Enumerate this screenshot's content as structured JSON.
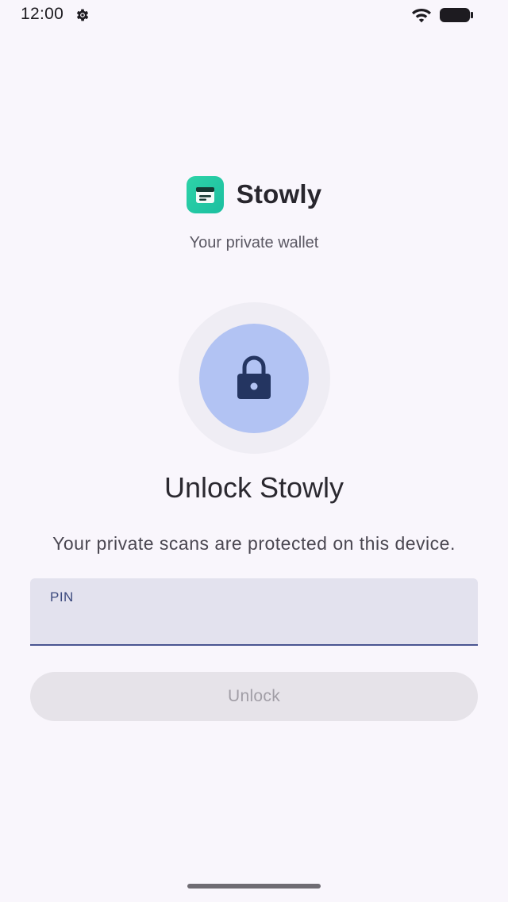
{
  "status_bar": {
    "time": "12:00",
    "icons": [
      "settings-gear-icon",
      "wifi-icon",
      "battery-icon"
    ]
  },
  "brand": {
    "app_name": "Stowly",
    "tagline": "Your private wallet",
    "logo_icon": "wallet-icon",
    "logo_color": "#22c9a4"
  },
  "lock": {
    "icon": "lock-icon",
    "outer_color": "#efedf4",
    "inner_color": "#b2c3f3",
    "icon_color": "#243561"
  },
  "unlock": {
    "title": "Unlock Stowly",
    "subtitle": "Your private scans are protected on this device.",
    "pin_label": "PIN",
    "pin_value": "",
    "button_label": "Unlock",
    "button_enabled": false
  }
}
